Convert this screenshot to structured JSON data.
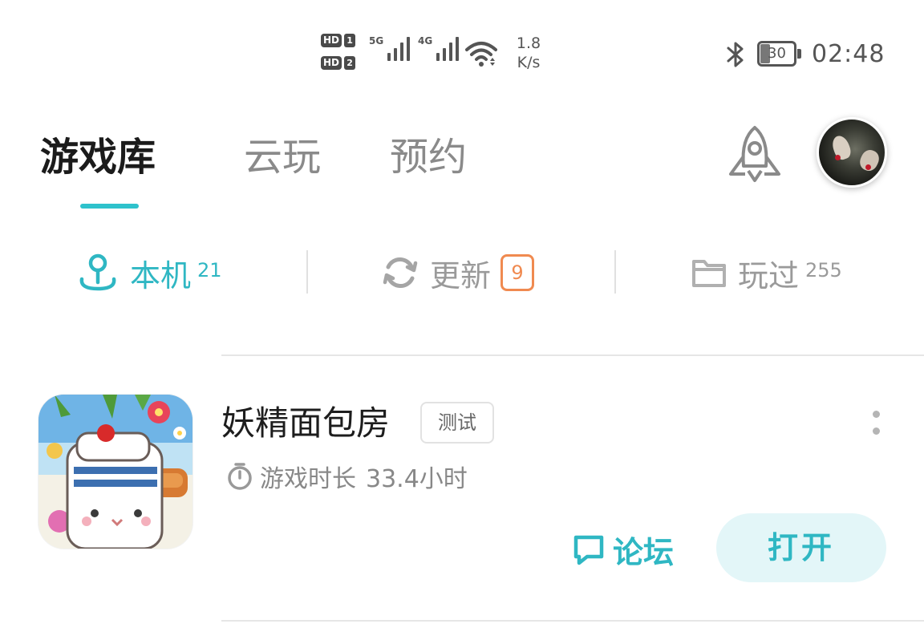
{
  "status_bar": {
    "hd_labels": [
      "HD",
      "HD"
    ],
    "sim_numbers": [
      "1",
      "2"
    ],
    "network_1": "5G",
    "network_2": "4G",
    "speed_value": "1.8",
    "speed_unit": "K/s",
    "battery_percent": "30",
    "time": "02:48"
  },
  "tabs": {
    "library": "游戏库",
    "cloud": "云玩",
    "reserve": "预约",
    "active": "library"
  },
  "filters": {
    "local_label": "本机",
    "local_count": "21",
    "update_label": "更新",
    "update_count": "9",
    "played_label": "玩过",
    "played_count": "255"
  },
  "games": [
    {
      "title": "妖精面包房",
      "badge": "测试",
      "playtime_label": "游戏时长",
      "playtime_value": "33.4小时",
      "forum_label": "论坛",
      "open_label": "打开"
    }
  ],
  "colors": {
    "accent": "#2ec2cc",
    "badge_orange": "#f08a50",
    "muted": "#8a8a8a"
  }
}
